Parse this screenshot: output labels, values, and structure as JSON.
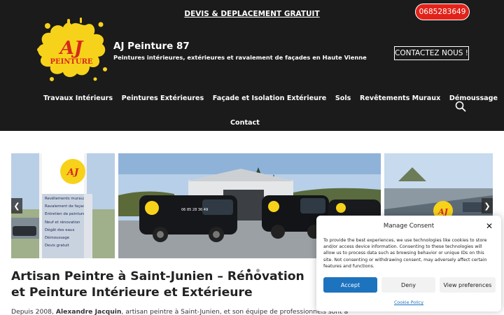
{
  "header": {
    "promo_link": "DEVIS & DEPLACEMENT GRATUIT",
    "phone": "0685283649",
    "site_title": "AJ Peinture 87",
    "tagline": "Peintures intérieures, extérieures et ravalement de façades en Haute Vienne",
    "contact_button": "CONTACTEZ NOUS !",
    "logo": {
      "mark": "AJ",
      "word": "PEINTURE"
    },
    "colors": {
      "background": "#1b1b1b",
      "phone_button": "#e2231a",
      "logo_yellow": "#f7d21a",
      "logo_red": "#d8281c"
    }
  },
  "nav": {
    "items": [
      "Travaux Intérieurs",
      "Peintures Extérieures",
      "Façade et Isolation Extérieure",
      "Sols",
      "Revêtements Muraux",
      "Démoussage",
      "Contact"
    ],
    "search_icon": "search-icon"
  },
  "carousel": {
    "slides": [
      {
        "content": "sign-post-with-services",
        "sign_lines": [
          "Revêtements muraux",
          "Ravalement de façades",
          "Entretien de peinture",
          "Neuf et rénovation",
          "Dégât des eaux",
          "Démoussage",
          "Devis gratuit"
        ]
      },
      {
        "content": "company-vans-in-front-of-workshop",
        "van_text": "06 85 28 36 49"
      },
      {
        "content": "roof-work-with-logo"
      }
    ],
    "prev_icon": "chevron-left-icon",
    "next_icon": "chevron-right-icon",
    "dots": 2,
    "active_dot": 0
  },
  "content": {
    "heading": "Artisan Peintre à Saint-Junien – Rénovation et Peinture Intérieure et Extérieure",
    "intro_before": "Depuis 2008, ",
    "intro_name": "Alexandre Jacquin",
    "intro_after": ", artisan peintre à Saint-Junien, et son équipe de professionnels sont à"
  },
  "consent": {
    "title": "Manage Consent",
    "text": "To provide the best experiences, we use technologies like cookies to store and/or access device information. Consenting to these technologies will allow us to process data such as browsing behavior or unique IDs on this site. Not consenting or withdrawing consent, may adversely affect certain features and functions.",
    "accept": "Accept",
    "deny": "Deny",
    "preferences": "View preferences",
    "policy": "Cookie Policy",
    "close_icon": "close-icon",
    "accent": "#1e73be"
  }
}
